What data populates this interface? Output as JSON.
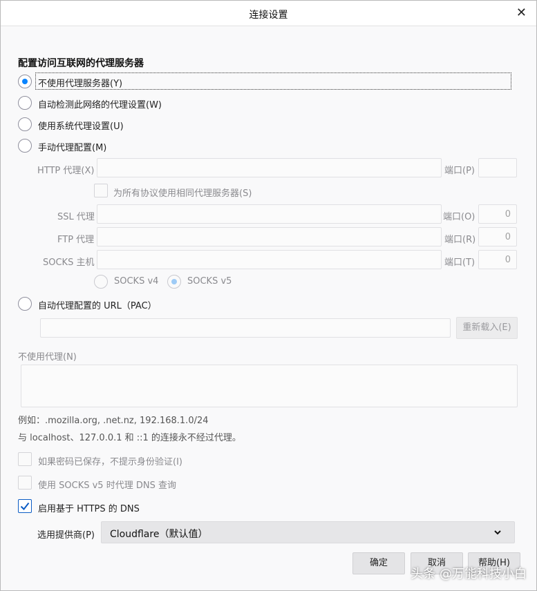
{
  "window": {
    "title": "连接设置",
    "close": "✕"
  },
  "section_heading": "配置访问互联网的代理服务器",
  "proxy_modes": [
    {
      "label": "不使用代理服务器(Y)",
      "selected": true
    },
    {
      "label": "自动检测此网络的代理设置(W)",
      "selected": false
    },
    {
      "label": "使用系统代理设置(U)",
      "selected": false
    },
    {
      "label": "手动代理配置(M)",
      "selected": false
    }
  ],
  "manual": {
    "http_label": "HTTP 代理(X)",
    "http_port_label": "端口(P)",
    "http_value": "",
    "http_port": "",
    "same_proxy_label": "为所有协议使用相同代理服务器(S)",
    "ssl_label": "SSL 代理",
    "ssl_port_label": "端口(O)",
    "ssl_port": "0",
    "ftp_label": "FTP 代理",
    "ftp_port_label": "端口(R)",
    "ftp_port": "0",
    "socks_label": "SOCKS 主机",
    "socks_port_label": "端口(T)",
    "socks_port": "0",
    "socks_v4": "SOCKS v4",
    "socks_v5": "SOCKS v5"
  },
  "pac": {
    "label": "自动代理配置的 URL（PAC）",
    "url": "",
    "reload_button": "重新载入(E)"
  },
  "no_proxy": {
    "label": "不使用代理(N)",
    "value": "",
    "example": "例如：.mozilla.org, .net.nz, 192.168.1.0/24",
    "note": "与 localhost、127.0.0.1 和 ::1 的连接永不经过代理。"
  },
  "options": {
    "no_auth_prompt": "如果密码已保存，不提示身份验证(I)",
    "socks_dns": "使用 SOCKS v5 时代理 DNS 查询",
    "doh": "启用基于 HTTPS 的 DNS",
    "doh_checked": true
  },
  "provider": {
    "label": "选用提供商(P)",
    "value": "Cloudflare（默认值）"
  },
  "buttons": {
    "ok": "确定",
    "cancel": "取消",
    "help": "帮助(H)"
  },
  "watermark": "头条 @万能科技小白",
  "icons": {
    "checkmark": "check-icon",
    "dropdown": "chevron-down-icon",
    "close": "close-icon"
  },
  "colors": {
    "accent": "#0a84ff",
    "disabled_text": "#8a8a8e"
  }
}
